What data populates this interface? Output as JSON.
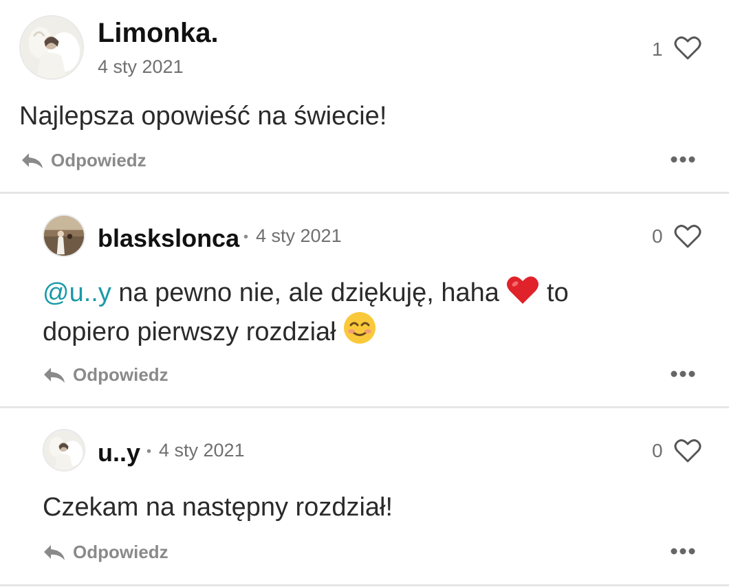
{
  "comments": [
    {
      "username": "Limonka.",
      "date": "4 sty 2021",
      "likes": "1",
      "text": "Najlepsza opowieść na świecie!",
      "reply_label": "Odpowiedz"
    },
    {
      "username": "blaskslonca",
      "separator": "•",
      "date": "4 sty 2021",
      "likes": "0",
      "mention": "@u..y",
      "text_part1": " na pewno nie, ale dziękuję, haha ",
      "text_part2": " to",
      "text_line2": "dopiero pierwszy rozdział ",
      "reply_label": "Odpowiedz"
    },
    {
      "username": "u..y",
      "separator": "•",
      "date": "4 sty 2021",
      "likes": "0",
      "text": "Czekam na następny rozdział!",
      "reply_label": "Odpowiedz"
    }
  ],
  "icons": {
    "like": "heart-outline-icon",
    "reply": "reply-arrow-icon",
    "more": "more-dots-icon",
    "emoji_heart": "red-heart-emoji",
    "emoji_smile": "smiling-face-emoji"
  },
  "colors": {
    "mention": "#1a9aa8",
    "muted": "#8a8a8a",
    "divider": "#e6e6e6",
    "heart_emoji": "#e0222a",
    "smile_emoji": "#f9c93b"
  }
}
